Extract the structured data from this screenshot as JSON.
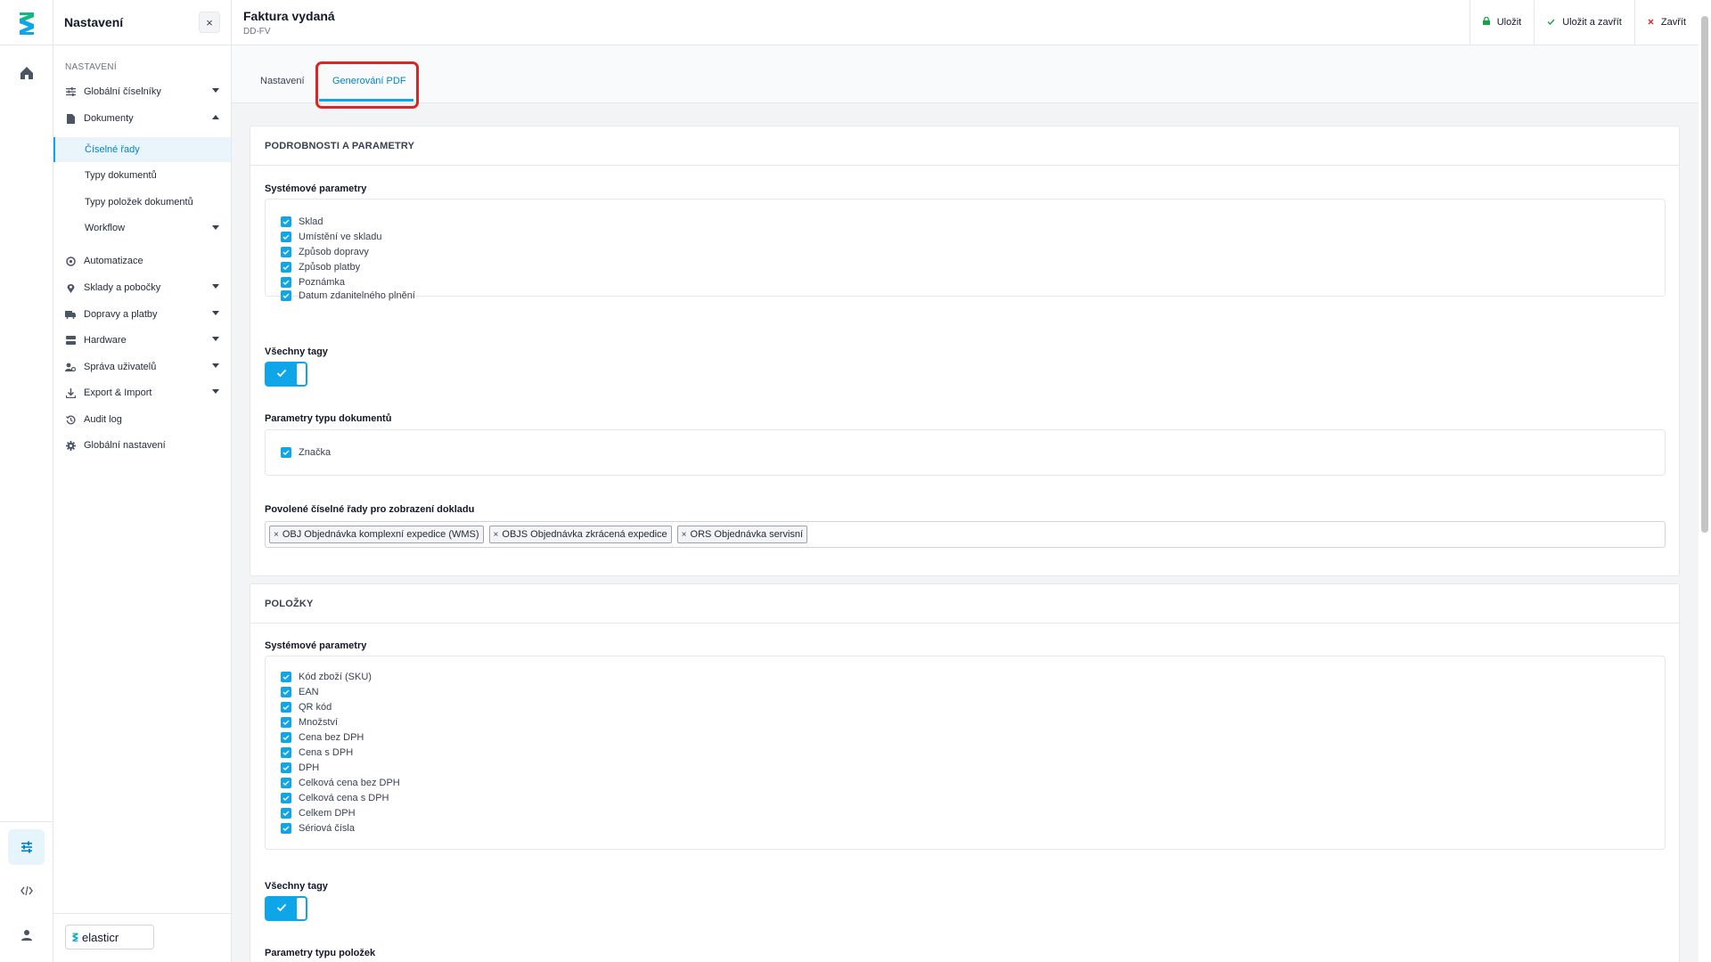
{
  "sidebar": {
    "title": "Nastavení",
    "close_label": "×",
    "section_label": "NASTAVENÍ",
    "items": [
      {
        "label": "Globální číselníky"
      },
      {
        "label": "Dokumenty"
      },
      {
        "label": "Automatizace"
      },
      {
        "label": "Sklady a pobočky"
      },
      {
        "label": "Dopravy a platby"
      },
      {
        "label": "Hardware"
      },
      {
        "label": "Správa uživatelů"
      },
      {
        "label": "Export & Import"
      },
      {
        "label": "Audit log"
      },
      {
        "label": "Globální nastavení"
      }
    ],
    "sub_items": [
      {
        "label": "Číselné řady"
      },
      {
        "label": "Typy dokumentů"
      },
      {
        "label": "Typy položek dokumentů"
      },
      {
        "label": "Workflow"
      }
    ],
    "brand": "elasticr"
  },
  "header": {
    "title": "Faktura vydaná",
    "code": "DD-FV",
    "save_label": "Uložit",
    "save_close_label": "Uložit a zavřít",
    "close_label": "Zavřít"
  },
  "tabs": [
    {
      "label": "Nastavení"
    },
    {
      "label": "Generování PDF",
      "active": true
    }
  ],
  "details": {
    "heading": "PODROBNOSTI A PARAMETRY",
    "system_params_label": "Systémové parametry",
    "system_params": [
      "Sklad",
      "Umístění ve skladu",
      "Způsob dopravy",
      "Způsob platby",
      "Poznámka",
      "Datum zdanitelného plnění"
    ],
    "all_tags_label": "Všechny tagy",
    "doc_type_params_label": "Parametry typu dokumentů",
    "doc_type_params": [
      "Značka"
    ],
    "allowed_series_label": "Povolené číselné řady pro zobrazení dokladu",
    "allowed_series": [
      "OBJ Objednávka komplexní expedice (WMS)",
      "OBJS Objednávka zkrácená expedice",
      "ORS Objednávka servisní"
    ]
  },
  "items_card": {
    "heading": "POLOŽKY",
    "system_params_label": "Systémové parametry",
    "system_params": [
      "Kód zboží (SKU)",
      "EAN",
      "QR kód",
      "Množství",
      "Cena bez DPH",
      "Cena s DPH",
      "DPH",
      "Celková cena bez DPH",
      "Celková cena s DPH",
      "Celkem DPH",
      "Sériová čísla"
    ],
    "all_tags_label": "Všechny tagy",
    "item_type_params_label": "Parametry typu položek"
  },
  "colors": {
    "accent": "#0ea5e9",
    "highlight": "#dc2626",
    "save_icon": "#16a34a",
    "close_icon": "#dc2626"
  }
}
